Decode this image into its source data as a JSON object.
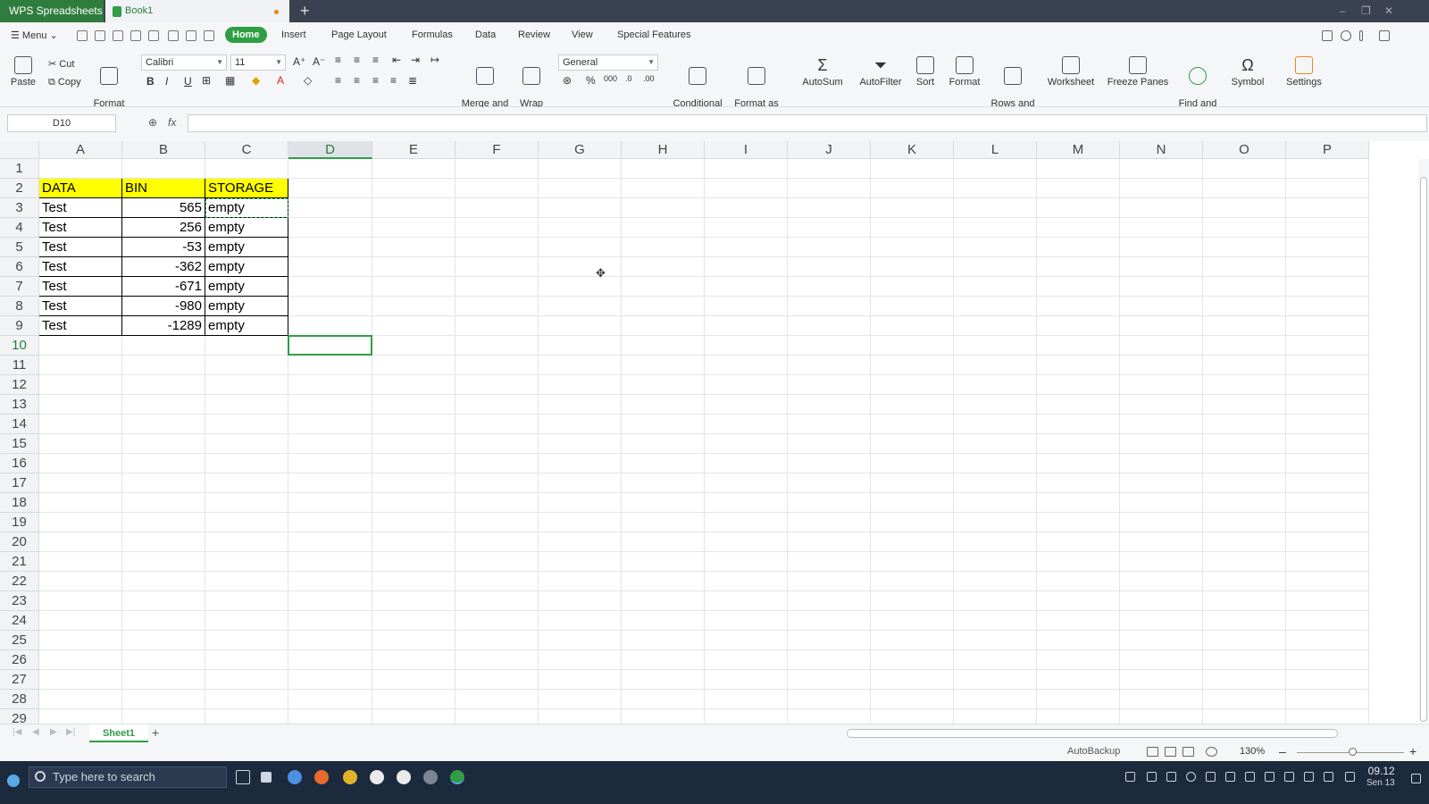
{
  "titlebar": {
    "app_name": "WPS Spreadsheets",
    "doc_name": "Book1",
    "new_tab": "+",
    "minimize": "–",
    "restore": "❐",
    "close": "✕"
  },
  "menubar": {
    "menu_label": "☰ Menu ⌄",
    "tabs": [
      "Home",
      "Insert",
      "Page Layout",
      "Formulas",
      "Data",
      "Review",
      "View",
      "Special Features"
    ],
    "active_tab": "Home"
  },
  "ribbon": {
    "paste": "Paste",
    "cut": "Cut",
    "copy": "Copy",
    "format_painter": "Format\nPainter",
    "font_name": "Calibri",
    "font_size": "11",
    "bold": "B",
    "italic": "I",
    "underline": "U",
    "merge_center": "Merge and\nCenter",
    "wrap_text": "Wrap\nText",
    "number_format": "General",
    "percent": "%",
    "conditional_formatting": "Conditional\nFormatting",
    "format_as_table": "Format as\nTable",
    "autosum": "AutoSum",
    "autofilter": "AutoFilter",
    "sort": "Sort",
    "format": "Format",
    "rows_columns": "Rows and\nColumns",
    "worksheet": "Worksheet",
    "freeze_panes": "Freeze Panes",
    "find_replace": "Find and\nReplace",
    "symbol": "Symbol",
    "settings": "Settings"
  },
  "formula_bar": {
    "name_box": "D10",
    "fx": "fx",
    "formula_value": ""
  },
  "sheet": {
    "columns": [
      "A",
      "B",
      "C",
      "D",
      "E",
      "F",
      "G",
      "H",
      "I",
      "J",
      "K",
      "L",
      "M",
      "N",
      "O",
      "P"
    ],
    "rows": [
      "1",
      "2",
      "3",
      "4",
      "5",
      "6",
      "7",
      "8",
      "9",
      "10",
      "11",
      "12",
      "13",
      "14",
      "15",
      "16",
      "17",
      "18",
      "19",
      "20",
      "21",
      "22",
      "23",
      "24",
      "25",
      "26",
      "27",
      "28",
      "29"
    ],
    "selected_column": "D",
    "selected_row": "10",
    "header_row": [
      "DATA",
      "BIN",
      "STORAGE"
    ],
    "data_rows": [
      [
        "Test",
        "565",
        "empty"
      ],
      [
        "Test",
        "256",
        "empty"
      ],
      [
        "Test",
        "-53",
        "empty"
      ],
      [
        "Test",
        "-362",
        "empty"
      ],
      [
        "Test",
        "-671",
        "empty"
      ],
      [
        "Test",
        "-980",
        "empty"
      ],
      [
        "Test",
        "-1289",
        "empty"
      ]
    ],
    "header_fill": "#ffff00",
    "accent": "#2f9e44"
  },
  "sheet_tabs": {
    "tabs": [
      "Sheet1"
    ],
    "add": "+"
  },
  "statusbar": {
    "autobackup": "AutoBackup",
    "zoom": "130%",
    "zoom_out": "–",
    "zoom_in": "+"
  },
  "taskbar": {
    "search_placeholder": "Type here to search",
    "time": "09.12",
    "date": "Sen 13"
  }
}
